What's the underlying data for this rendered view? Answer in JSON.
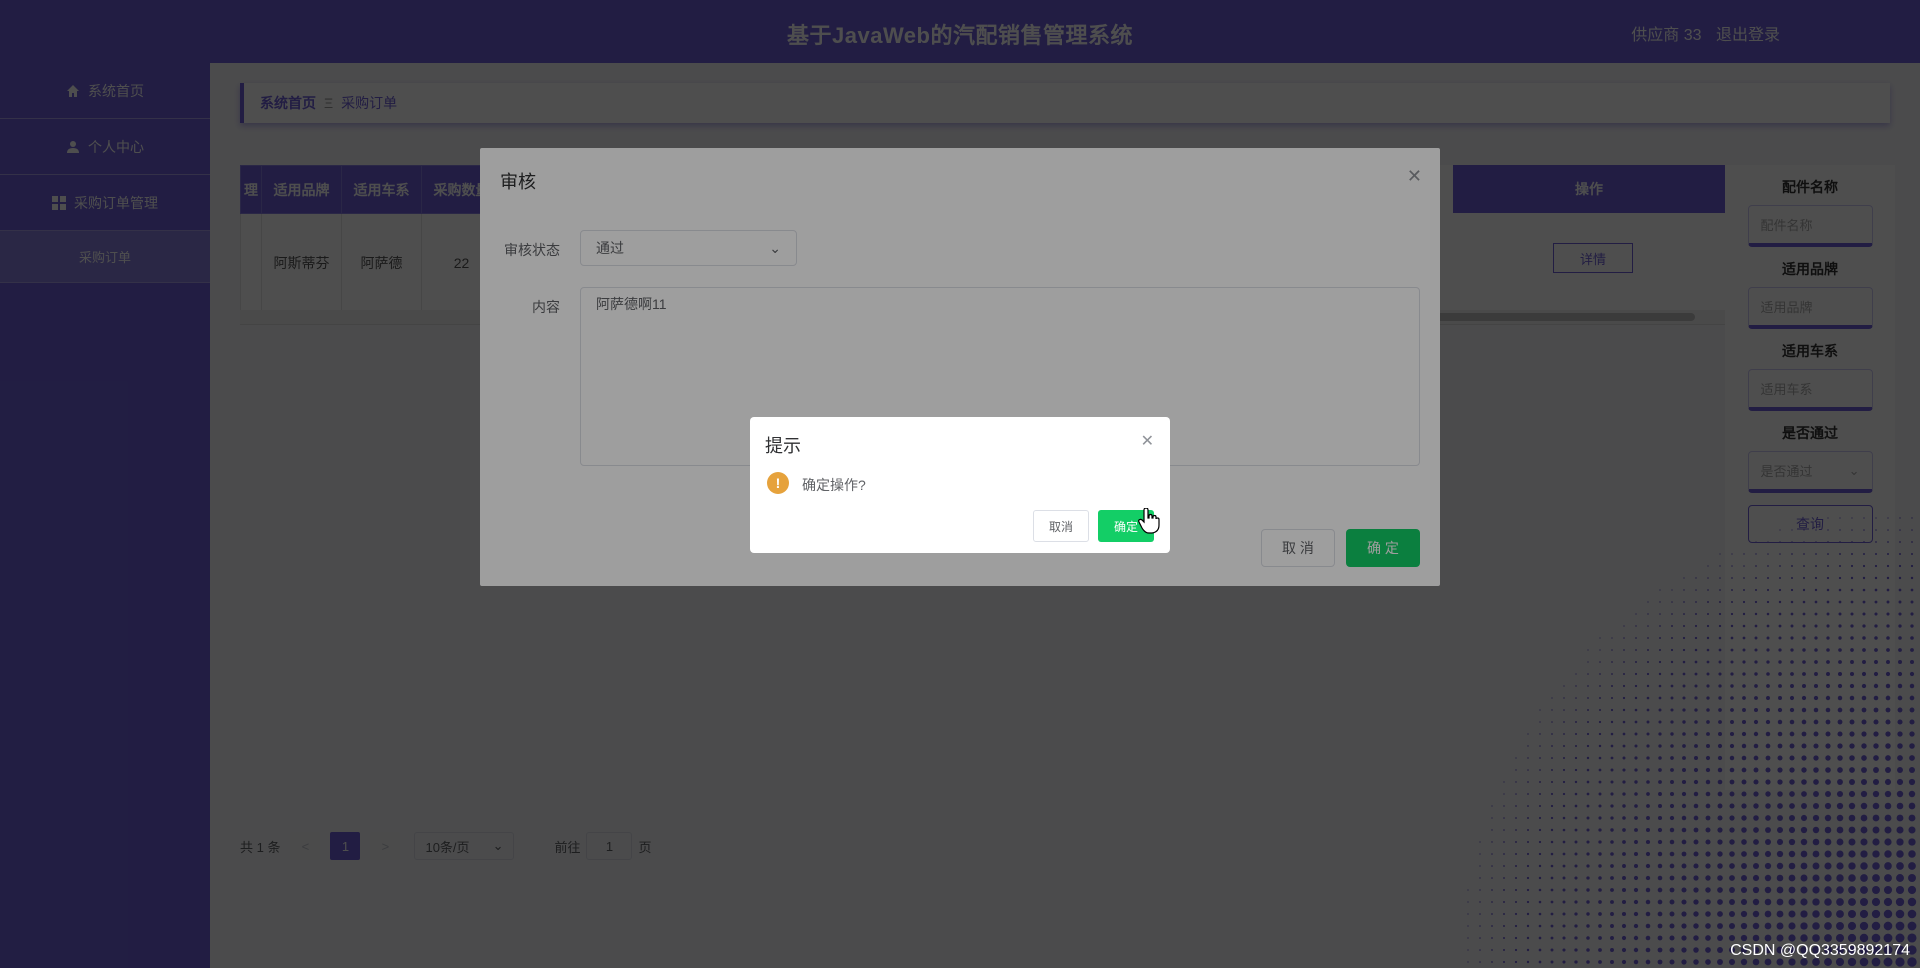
{
  "header": {
    "title": "基于JavaWeb的汽配销售管理系统",
    "user": "供应商 33",
    "logout": "退出登录"
  },
  "sidebar": {
    "items": [
      {
        "label": "系统首页",
        "icon": "home-icon"
      },
      {
        "label": "个人中心",
        "icon": "user-icon"
      },
      {
        "label": "采购订单管理",
        "icon": "grid-icon"
      },
      {
        "label": "采购订单",
        "icon": ""
      }
    ]
  },
  "breadcrumb": {
    "home": "系统首页",
    "separator": "Ξ",
    "current": "采购订单"
  },
  "table": {
    "columns": [
      "理",
      "适用品牌",
      "适用车系",
      "采购数量"
    ],
    "row": [
      "",
      "阿斯蒂芬",
      "阿萨德",
      "22"
    ],
    "op_header": "操作",
    "detail_button": "详情"
  },
  "search": {
    "fields": [
      {
        "label": "配件名称",
        "placeholder": "配件名称"
      },
      {
        "label": "适用品牌",
        "placeholder": "适用品牌"
      },
      {
        "label": "适用车系",
        "placeholder": "适用车系"
      },
      {
        "label": "是否通过",
        "placeholder": "是否通过"
      }
    ],
    "query_button": "查询"
  },
  "pager": {
    "total": "共 1 条",
    "prev": "<",
    "current_page": "1",
    "next": ">",
    "page_size": "10条/页",
    "goto_prefix": "前往",
    "goto_value": "1",
    "goto_suffix": "页"
  },
  "audit_dialog": {
    "title": "审核",
    "status_label": "审核状态",
    "status_value": "通过",
    "content_label": "内容",
    "content_value": "阿萨德啊11",
    "cancel": "取 消",
    "confirm": "确 定"
  },
  "confirm_box": {
    "title": "提示",
    "message": "确定操作?",
    "cancel": "取消",
    "confirm": "确定"
  },
  "watermark": "CSDN @QQ3359892174",
  "colors": {
    "brand": "#6f60d8",
    "success": "#13ce66",
    "warning": "#e6a23c"
  }
}
